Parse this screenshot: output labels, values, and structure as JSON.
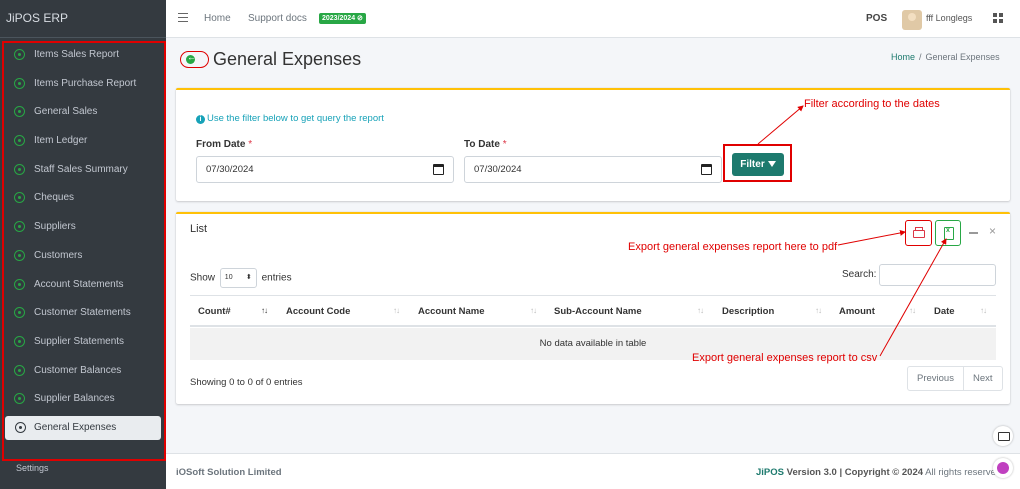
{
  "app": {
    "title": "JiPOS ERP"
  },
  "sidebar": {
    "items": [
      {
        "label": "Items Sales Report"
      },
      {
        "label": "Items Purchase Report"
      },
      {
        "label": "General Sales"
      },
      {
        "label": "Item Ledger"
      },
      {
        "label": "Staff Sales Summary"
      },
      {
        "label": "Cheques"
      },
      {
        "label": "Suppliers"
      },
      {
        "label": "Customers"
      },
      {
        "label": "Account Statements"
      },
      {
        "label": "Customer Statements"
      },
      {
        "label": "Supplier Statements"
      },
      {
        "label": "Customer Balances"
      },
      {
        "label": "Supplier Balances"
      },
      {
        "label": "General Expenses"
      }
    ],
    "active_item": "General Expenses",
    "settings_label": "Settings"
  },
  "topnav": {
    "home": "Home",
    "support": "Support docs",
    "year_badge": "2023/2024",
    "pos": "POS",
    "username": "fff Longlegs"
  },
  "page": {
    "title": "General Expenses",
    "breadcrumb": {
      "home": "Home",
      "sep": "/",
      "current": "General Expenses"
    }
  },
  "filter": {
    "info": "Use the filter below to get query the report",
    "from_label": "From Date",
    "to_label": "To Date",
    "required_mark": "*",
    "from_value": "07/30/2024",
    "to_value": "07/30/2024",
    "button_label": "Filter"
  },
  "list": {
    "title": "List",
    "show_label": "Show",
    "entries_value": "10",
    "entries_label": "entries",
    "search_label": "Search:",
    "columns": [
      "Count#",
      "Account Code",
      "Account Name",
      "Sub-Account Name",
      "Description",
      "Amount",
      "Date"
    ],
    "empty_message": "No data available in table",
    "info": "Showing 0 to 0 of 0 entries",
    "pagination": {
      "previous": "Previous",
      "next": "Next"
    }
  },
  "annotations": {
    "filter": "Filter according to the dates",
    "pdf": "Export general expenses report here to pdf",
    "csv": "Export general expenses report to csv",
    "color": "#e00000"
  },
  "footer": {
    "company": "iOSoft Solution Limited",
    "brand": "JiPOS",
    "version": "Version 3.0",
    "copyright": "Copyright © 2024",
    "rights": "All rights reserved."
  },
  "colors": {
    "accent": "#1d7a6e",
    "sidebar_bg": "#343a40",
    "card_top": "#ffc107",
    "success": "#28a745"
  }
}
